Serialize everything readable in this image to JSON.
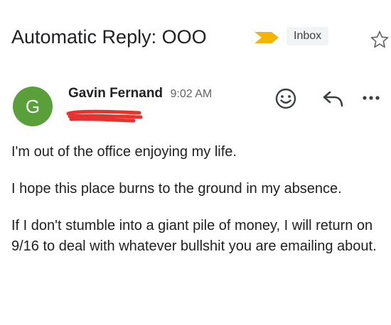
{
  "email": {
    "subject": "Automatic Reply: OOO",
    "label": "Inbox",
    "sender": {
      "initial": "G",
      "name": "Gavin Fernand",
      "time": "9:02 AM"
    },
    "body": [
      "I'm out of the office enjoying my life.",
      "I hope this place burns to the ground in my absence.",
      "If I don't stumble into a giant pile of money, I will return on 9/16 to deal with whatever bullshit you are emailing about."
    ]
  },
  "colors": {
    "avatar": "#59a03b",
    "importance_marker": "#f4b400",
    "redaction": "#e8322f",
    "icon": "#5f6368"
  },
  "icons": {
    "importance": "importance-marker-icon",
    "star": "star-icon",
    "emoji": "emoji-reaction-icon",
    "reply": "reply-icon",
    "more": "more-options-icon"
  }
}
